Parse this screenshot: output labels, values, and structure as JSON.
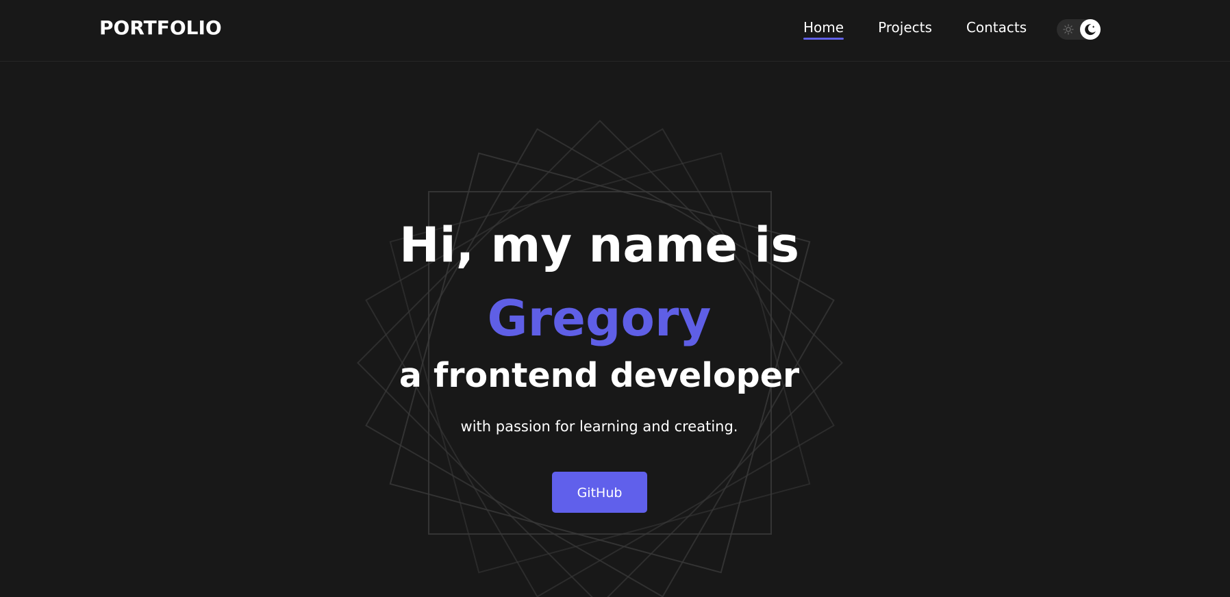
{
  "header": {
    "logo": "PORTFOLIO",
    "nav": [
      {
        "label": "Home",
        "active": true
      },
      {
        "label": "Projects",
        "active": false
      },
      {
        "label": "Contacts",
        "active": false
      }
    ],
    "theme_toggle": {
      "state": "dark",
      "left_icon": "sun-icon",
      "knob_icon": "moon-icon"
    }
  },
  "hero": {
    "greeting": "Hi, my name is",
    "name": "Gregory",
    "role": "a frontend developer",
    "tagline": "with passion for learning and creating.",
    "button_label": "GitHub"
  },
  "colors": {
    "background": "#181818",
    "accent": "#6060eb",
    "text": "#ffffff",
    "decor_lines": "#3a3a3a"
  }
}
